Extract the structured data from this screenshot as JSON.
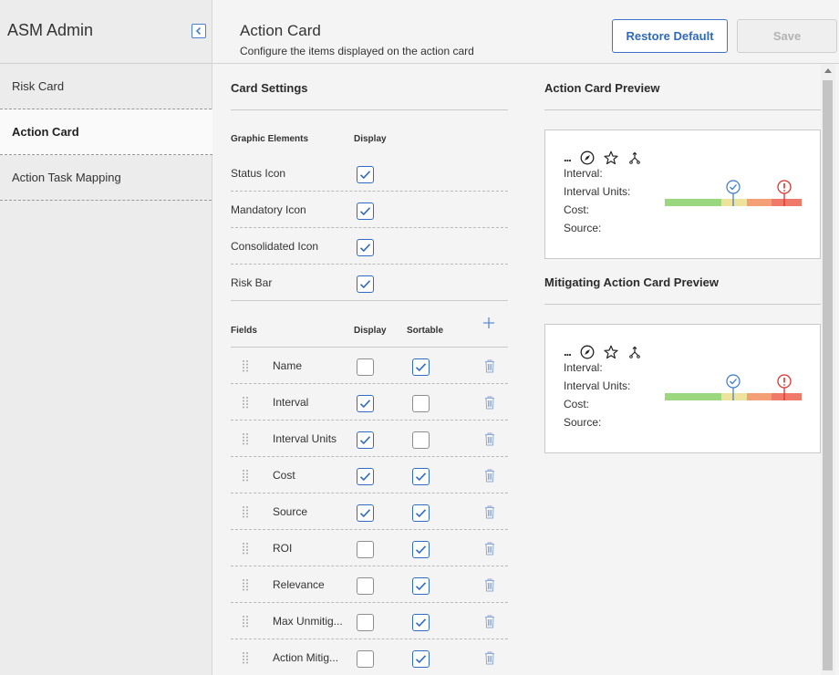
{
  "sidebar": {
    "title": "ASM Admin",
    "items": [
      {
        "label": "Risk Card",
        "active": false
      },
      {
        "label": "Action Card",
        "active": true
      },
      {
        "label": "Action Task Mapping",
        "active": false
      }
    ]
  },
  "header": {
    "title": "Action Card",
    "subtitle": "Configure the items displayed on the action card",
    "restore_label": "Restore Default",
    "save_label": "Save"
  },
  "settings": {
    "title": "Card Settings",
    "graphic_header": "Graphic Elements",
    "display_header": "Display",
    "graphic_elements": [
      {
        "label": "Status Icon",
        "display": true
      },
      {
        "label": "Mandatory Icon",
        "display": true
      },
      {
        "label": "Consolidated Icon",
        "display": true
      },
      {
        "label": "Risk Bar",
        "display": true
      }
    ],
    "fields_header": "Fields",
    "fields_display_header": "Display",
    "sortable_header": "Sortable",
    "fields": [
      {
        "label": "Name",
        "display": false,
        "sortable": true
      },
      {
        "label": "Interval",
        "display": true,
        "sortable": false
      },
      {
        "label": "Interval Units",
        "display": true,
        "sortable": false
      },
      {
        "label": "Cost",
        "display": true,
        "sortable": true
      },
      {
        "label": "Source",
        "display": true,
        "sortable": true
      },
      {
        "label": "ROI",
        "display": false,
        "sortable": true
      },
      {
        "label": "Relevance",
        "display": false,
        "sortable": true
      },
      {
        "label": "Max Unmitig...",
        "display": false,
        "sortable": true
      },
      {
        "label": "Action Mitig...",
        "display": false,
        "sortable": true
      }
    ]
  },
  "previews": [
    {
      "title": "Action Card Preview",
      "dots": "...",
      "fields": [
        "Interval:",
        "Interval Units:",
        "Cost:",
        "Source:"
      ]
    },
    {
      "title": "Mitigating Action Card Preview",
      "dots": "...",
      "fields": [
        "Interval:",
        "Interval Units:",
        "Cost:",
        "Source:"
      ]
    }
  ],
  "colors": {
    "accent": "#2f6bc4",
    "risk_green": "#9bd77e",
    "risk_yellow": "#ede39c",
    "risk_orange": "#f4a076",
    "risk_red": "#f07a6a",
    "alert_red": "#e0302a"
  }
}
